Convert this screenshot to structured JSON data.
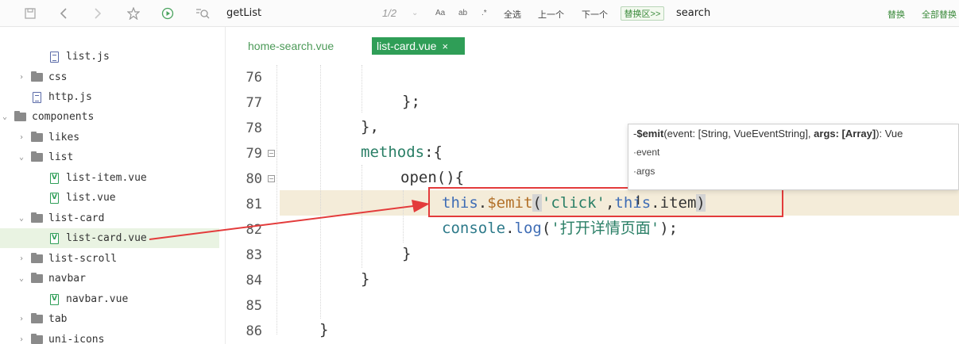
{
  "toolbar": {
    "icons": [
      "save-icon",
      "back-arrow-icon",
      "forward-arrow-icon",
      "star-icon",
      "run-icon",
      "find-icon"
    ],
    "find_text": "getList",
    "match_count": "1/2",
    "option_case": "Aa",
    "option_word": "ab",
    "option_regex": ".*",
    "select_all": "全选",
    "prev": "上一个",
    "next": "下一个",
    "replace_area": "替换区>>",
    "replace_text": "search",
    "replace": "替换",
    "replace_all": "全部替换"
  },
  "sidebar": {
    "items": [
      {
        "label": "list.js",
        "kind": "js-file"
      },
      {
        "label": "css",
        "kind": "folder",
        "state": "collapsed"
      },
      {
        "label": "http.js",
        "kind": "js-file"
      },
      {
        "label": "components",
        "kind": "folder",
        "state": "expanded"
      },
      {
        "label": "likes",
        "kind": "folder",
        "state": "collapsed"
      },
      {
        "label": "list",
        "kind": "folder",
        "state": "expanded"
      },
      {
        "label": "list-item.vue",
        "kind": "vue-file"
      },
      {
        "label": "list.vue",
        "kind": "vue-file"
      },
      {
        "label": "list-card",
        "kind": "folder",
        "state": "expanded"
      },
      {
        "label": "list-card.vue",
        "kind": "vue-file",
        "selected": true
      },
      {
        "label": "list-scroll",
        "kind": "folder",
        "state": "collapsed"
      },
      {
        "label": "navbar",
        "kind": "folder",
        "state": "expanded"
      },
      {
        "label": "navbar.vue",
        "kind": "vue-file"
      },
      {
        "label": "tab",
        "kind": "folder",
        "state": "collapsed"
      },
      {
        "label": "uni-icons",
        "kind": "folder",
        "state": "collapsed"
      }
    ]
  },
  "tabs": [
    {
      "label": "home-search.vue",
      "active": false
    },
    {
      "label": "list-card.vue",
      "active": true,
      "close": "×"
    }
  ],
  "line_numbers": [
    "76",
    "77",
    "78",
    "79",
    "80",
    "81",
    "82",
    "83",
    "84",
    "85",
    "86"
  ],
  "code": {
    "l77": "};",
    "l78": "},",
    "l79_name": "methods",
    "l79_rest": ":{",
    "l80": "open(){",
    "l81_this": "this",
    "l81_dot": ".",
    "l81_emit": "$emit",
    "l81_open": "(",
    "l81_str": "'click'",
    "l81_comma": ",",
    "l81_this2": "this",
    "l81_dot2": ".",
    "l81_item": "item",
    "l81_close": ")",
    "l82_console": "console",
    "l82_dot": ".",
    "l82_log": "log",
    "l82_open": "(",
    "l82_str": "'打开详情页面'",
    "l82_close": ");",
    "l83": "}",
    "l84": "}",
    "l86": "}"
  },
  "tooltip": {
    "prefix": "-",
    "name": "$emit",
    "params": "(event: [String, VueEventString], ",
    "args_label": "args: [Array]",
    "ret": "): Vue",
    "param1": "·event",
    "param2": "·args"
  },
  "colors": {
    "accent_green": "#2f9e57",
    "annotation_red": "#e33b3b",
    "line_highlight": "#f4ecd9"
  }
}
